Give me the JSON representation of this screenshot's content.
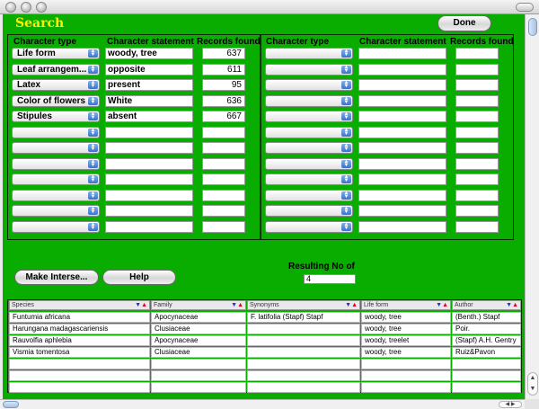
{
  "window": {
    "title": "Search"
  },
  "toolbar": {
    "done_label": "Done"
  },
  "headers": {
    "character_type": "Character type",
    "character_statement": "Character statement",
    "records_found": "Records found"
  },
  "left_rows": [
    {
      "type": "Life form",
      "statement": "woody, tree",
      "records": "637"
    },
    {
      "type": "Leaf arrangem...",
      "statement": "opposite",
      "records": "611"
    },
    {
      "type": "Latex",
      "statement": "present",
      "records": "95"
    },
    {
      "type": "Color of flowers",
      "statement": "White",
      "records": "636"
    },
    {
      "type": "Stipules",
      "statement": "absent",
      "records": "667"
    },
    {
      "type": "",
      "statement": "",
      "records": ""
    },
    {
      "type": "",
      "statement": "",
      "records": ""
    },
    {
      "type": "",
      "statement": "",
      "records": ""
    },
    {
      "type": "",
      "statement": "",
      "records": ""
    },
    {
      "type": "",
      "statement": "",
      "records": ""
    },
    {
      "type": "",
      "statement": "",
      "records": ""
    },
    {
      "type": "",
      "statement": "",
      "records": ""
    }
  ],
  "right_rows": [
    {
      "type": "",
      "statement": "",
      "records": ""
    },
    {
      "type": "",
      "statement": "",
      "records": ""
    },
    {
      "type": "",
      "statement": "",
      "records": ""
    },
    {
      "type": "",
      "statement": "",
      "records": ""
    },
    {
      "type": "",
      "statement": "",
      "records": ""
    },
    {
      "type": "",
      "statement": "",
      "records": ""
    },
    {
      "type": "",
      "statement": "",
      "records": ""
    },
    {
      "type": "",
      "statement": "",
      "records": ""
    },
    {
      "type": "",
      "statement": "",
      "records": ""
    },
    {
      "type": "",
      "statement": "",
      "records": ""
    },
    {
      "type": "",
      "statement": "",
      "records": ""
    },
    {
      "type": "",
      "statement": "",
      "records": ""
    }
  ],
  "actions": {
    "make_intersect_label": "Make Interse...",
    "help_label": "Help"
  },
  "result": {
    "label": "Resulting No of",
    "value": "4"
  },
  "results_table": {
    "columns": [
      "Species",
      "Family",
      "Synonyms",
      "Life form",
      "Author"
    ],
    "rows": [
      [
        "Funtumia africana",
        "Apocynaceae",
        "F. latifolia (Stapf) Stapf",
        "woody, tree",
        "(Benth.) Stapf"
      ],
      [
        "Harungana madagascariensis",
        "Clusiaceae",
        "",
        "woody, tree",
        "Poir."
      ],
      [
        "Rauvolfia aphlebia",
        "Apocynaceae",
        "",
        "woody, treelet",
        "(Stapf) A.H. Gentry"
      ],
      [
        "Vismia tomentosa",
        "Clusiaceae",
        "",
        "woody, tree",
        "Ruiz&Pavon"
      ],
      [
        "",
        "",
        "",
        "",
        ""
      ],
      [
        "",
        "",
        "",
        "",
        ""
      ],
      [
        "",
        "",
        "",
        "",
        ""
      ]
    ]
  },
  "colors": {
    "background": "#08ad00",
    "title": "#ffee00",
    "sort_down": "#2a2ae0",
    "sort_up": "#e0002a"
  }
}
